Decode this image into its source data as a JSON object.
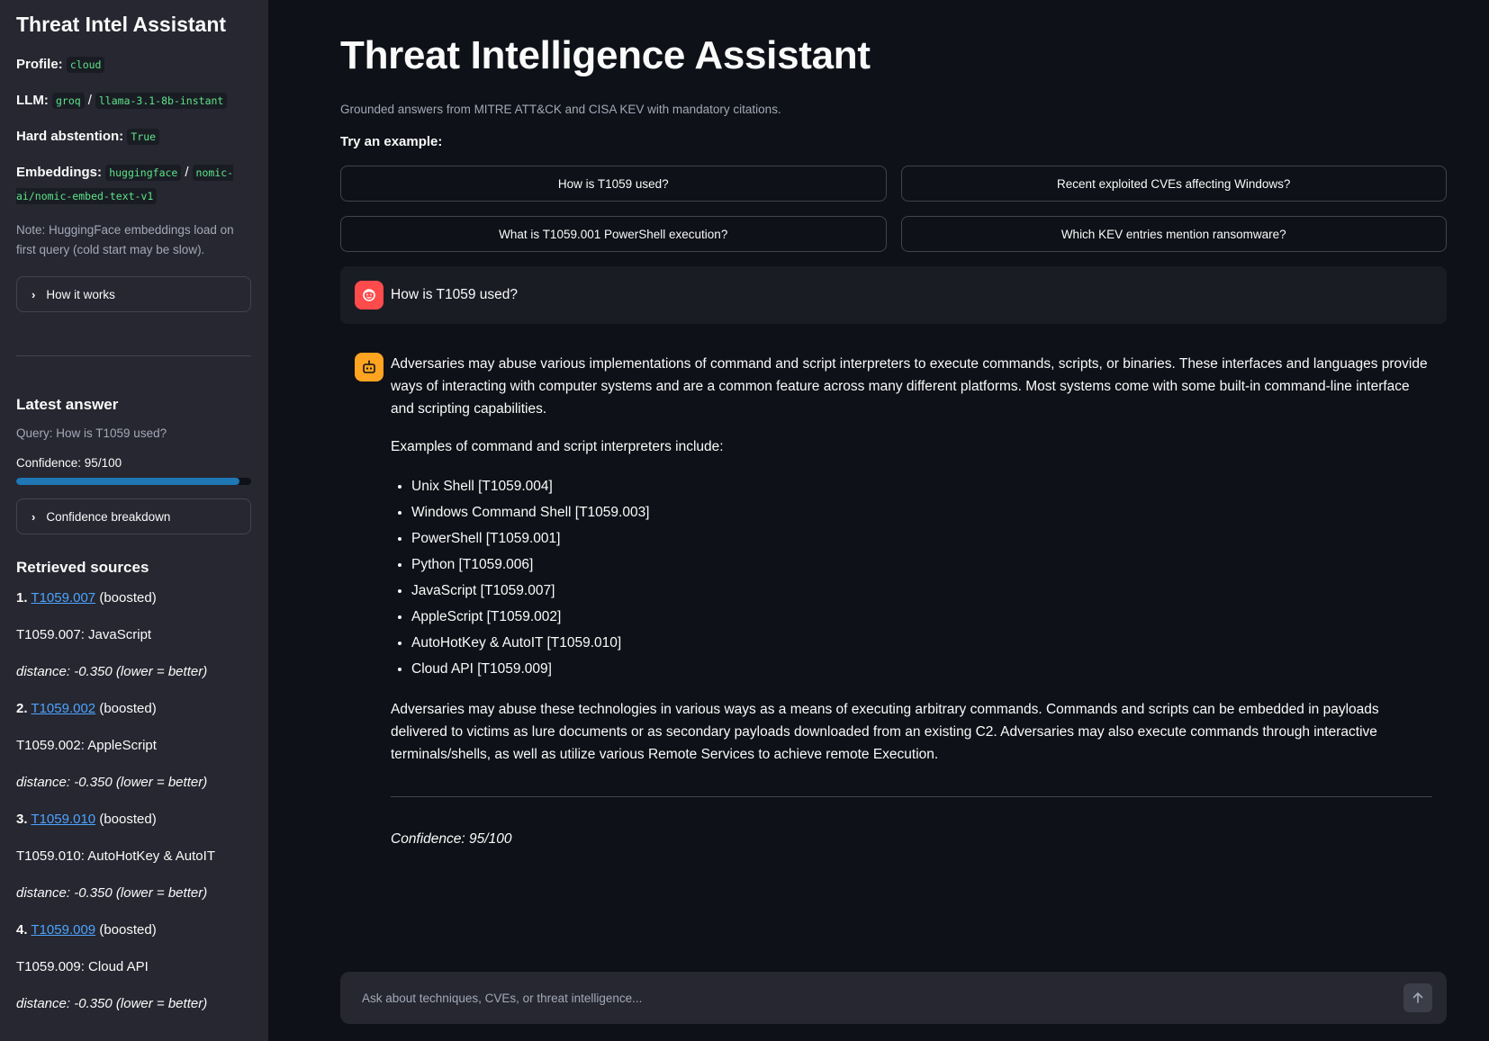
{
  "sidebar": {
    "title": "Threat Intel Assistant",
    "profile_label": "Profile:",
    "profile_value": "cloud",
    "llm_label": "LLM:",
    "llm_provider": "groq",
    "llm_model": "llama-3.1-8b-instant",
    "abstention_label": "Hard abstention:",
    "abstention_value": "True",
    "embeddings_label": "Embeddings:",
    "embeddings_provider": "huggingface",
    "embeddings_model": "nomic-ai/nomic-embed-text-v1",
    "note": "Note: HuggingFace embeddings load on first query (cold start may be slow).",
    "how_it_works": "How it works",
    "latest_answer_title": "Latest answer",
    "query": "Query: How is T1059 used?",
    "confidence": "Confidence: 95/100",
    "confidence_value": 95,
    "confidence_breakdown": "Confidence breakdown",
    "sources_title": "Retrieved sources",
    "sources": [
      {
        "num": "1.",
        "id": "T1059.007",
        "tag": "(boosted)",
        "title": "T1059.007: JavaScript",
        "distance": "distance: -0.350 (lower = better)"
      },
      {
        "num": "2.",
        "id": "T1059.002",
        "tag": "(boosted)",
        "title": "T1059.002: AppleScript",
        "distance": "distance: -0.350 (lower = better)"
      },
      {
        "num": "3.",
        "id": "T1059.010",
        "tag": "(boosted)",
        "title": "T1059.010: AutoHotKey & AutoIT",
        "distance": "distance: -0.350 (lower = better)"
      },
      {
        "num": "4.",
        "id": "T1059.009",
        "tag": "(boosted)",
        "title": "T1059.009: Cloud API",
        "distance": "distance: -0.350 (lower = better)"
      }
    ]
  },
  "main": {
    "title": "Threat Intelligence Assistant",
    "caption": "Grounded answers from MITRE ATT&CK and CISA KEV with mandatory citations.",
    "try_label": "Try an example:",
    "examples": [
      "How is T1059 used?",
      "Recent exploited CVEs affecting Windows?",
      "What is T1059.001 PowerShell execution?",
      "Which KEV entries mention ransomware?"
    ],
    "user_message": "How is T1059 used?",
    "bot": {
      "p1": "Adversaries may abuse various implementations of command and script interpreters to execute commands, scripts, or binaries. These interfaces and languages provide ways of interacting with computer systems and are a common feature across many different platforms. Most systems come with some built-in command-line interface and scripting capabilities.",
      "p2": "Examples of command and script interpreters include:",
      "items": [
        "Unix Shell [T1059.004]",
        "Windows Command Shell [T1059.003]",
        "PowerShell [T1059.001]",
        "Python [T1059.006]",
        "JavaScript [T1059.007]",
        "AppleScript [T1059.002]",
        "AutoHotKey & AutoIT [T1059.010]",
        "Cloud API [T1059.009]"
      ],
      "p3": "Adversaries may abuse these technologies in various ways as a means of executing arbitrary commands. Commands and scripts can be embedded in payloads delivered to victims as lure documents or as secondary payloads downloaded from an existing C2. Adversaries may also execute commands through interactive terminals/shells, as well as utilize various Remote Services to achieve remote Execution.",
      "confidence": "Confidence: 95/100"
    },
    "chat_placeholder": "Ask about techniques, CVEs, or threat intelligence..."
  },
  "colors": {
    "background": "#0e1117",
    "sidebar": "#262730",
    "accent_red": "#ff4b4b",
    "accent_orange": "#ffa421",
    "progress": "#1f77b4",
    "link": "#4da3ff"
  }
}
